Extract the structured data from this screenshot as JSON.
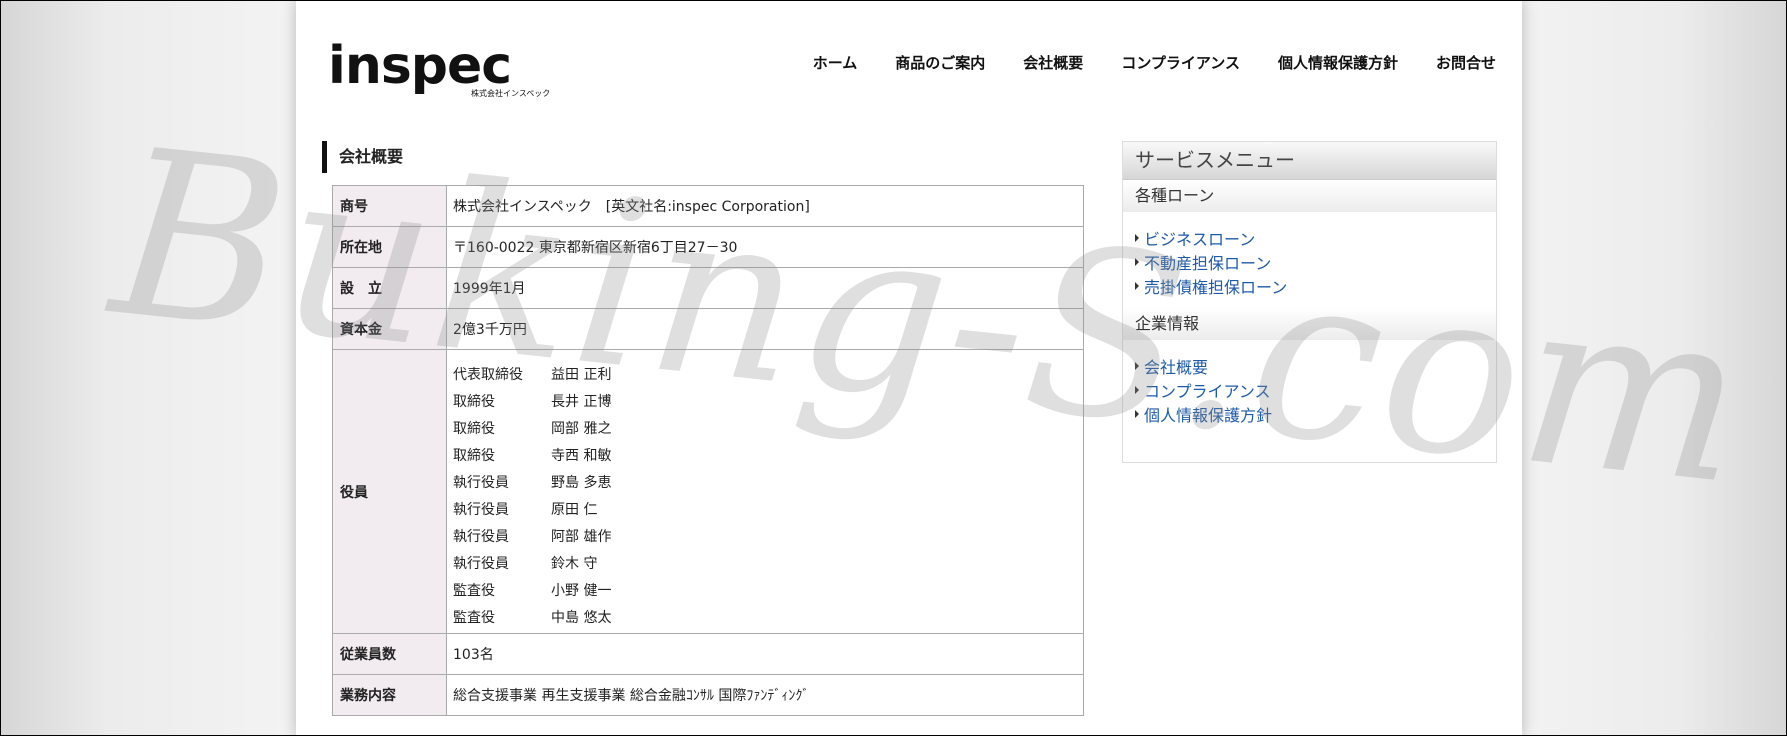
{
  "logo": {
    "word": "inspec",
    "sub": "株式会社インスペック"
  },
  "nav": [
    "ホーム",
    "商品のご案内",
    "会社概要",
    "コンプライアンス",
    "個人情報保護方針",
    "お問合せ"
  ],
  "section_title": "会社概要",
  "company": {
    "rows_top": [
      {
        "label": "商号",
        "value": "株式会社インスペック　[英文社名:inspec Corporation]"
      },
      {
        "label": "所在地",
        "value": "〒160-0022 東京都新宿区新宿6丁目27－30"
      },
      {
        "label": "設　立",
        "value": "1999年1月"
      },
      {
        "label": "資本金",
        "value": "2億3千万円"
      }
    ],
    "officers_label": "役員",
    "officers": [
      {
        "title": "代表取締役",
        "name": "益田 正利"
      },
      {
        "title": "取締役",
        "name": "長井 正博"
      },
      {
        "title": "取締役",
        "name": "岡部 雅之"
      },
      {
        "title": "取締役",
        "name": "寺西 和敏"
      },
      {
        "title": "執行役員",
        "name": "野島 多恵"
      },
      {
        "title": "執行役員",
        "name": "原田 仁"
      },
      {
        "title": "執行役員",
        "name": "阿部 雄作"
      },
      {
        "title": "執行役員",
        "name": "鈴木 守"
      },
      {
        "title": "監査役",
        "name": "小野 健一"
      },
      {
        "title": "監査役",
        "name": "中島 悠太"
      }
    ],
    "rows_bottom": [
      {
        "label": "従業員数",
        "value": "103名"
      },
      {
        "label": "業務内容",
        "value": "総合支援事業 再生支援事業 総合金融ｺﾝｻﾙ 国際ﾌｧﾝﾃﾞｨﾝｸﾞ"
      }
    ]
  },
  "sidebar": {
    "title": "サービスメニュー",
    "groups": [
      {
        "heading": "各種ローン",
        "items": [
          "ビジネスローン",
          "不動産担保ローン",
          "売掛債権担保ローン"
        ]
      },
      {
        "heading": "企業情報",
        "items": [
          "会社概要",
          "コンプライアンス",
          "個人情報保護方針"
        ]
      }
    ]
  },
  "watermark": "Buking-S.com"
}
